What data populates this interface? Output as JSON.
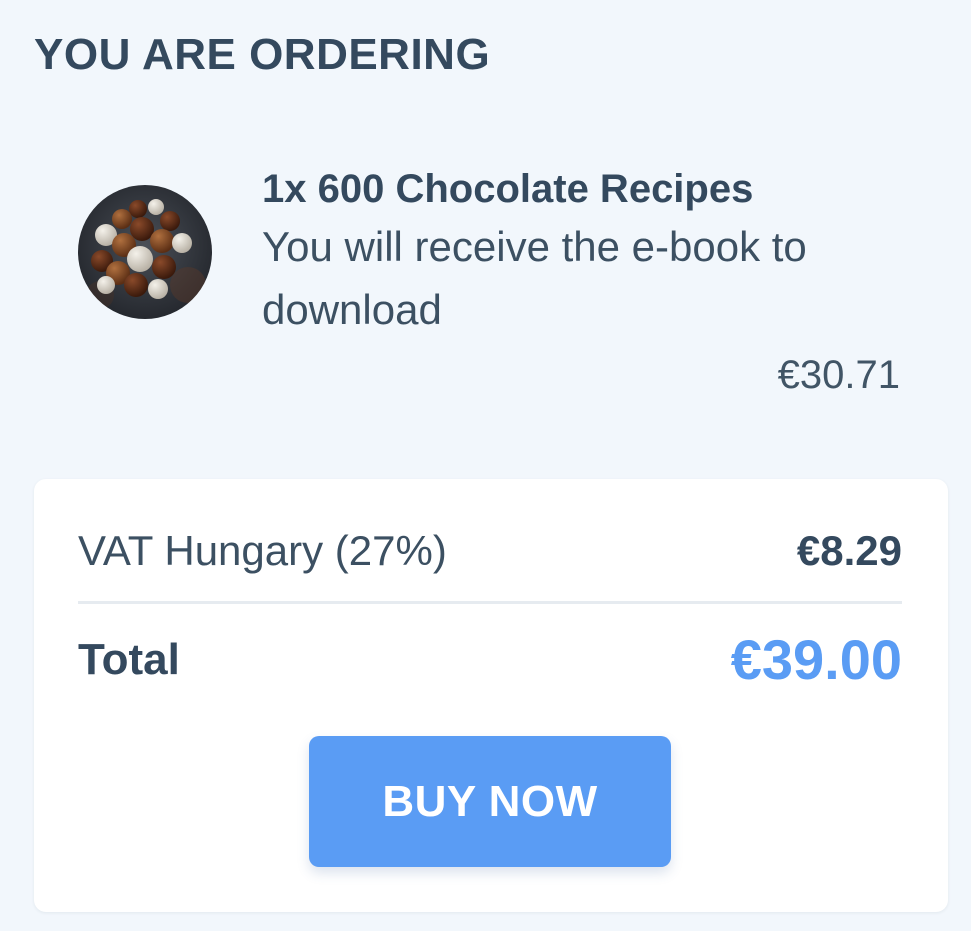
{
  "order": {
    "heading": "YOU ARE ORDERING"
  },
  "product": {
    "title": "1x 600 Chocolate Recipes",
    "description": "You will receive the e-book to download",
    "price": "€30.71",
    "image_icon": "chocolate-truffles-image"
  },
  "summary": {
    "vat_label": "VAT Hungary (27%)",
    "vat_value": "€8.29",
    "total_label": "Total",
    "total_value": "€39.00"
  },
  "actions": {
    "buy_label": "BUY NOW"
  },
  "colors": {
    "background": "#f2f7fc",
    "text": "#34495e",
    "accent": "#5a9cf4",
    "card": "#ffffff"
  }
}
